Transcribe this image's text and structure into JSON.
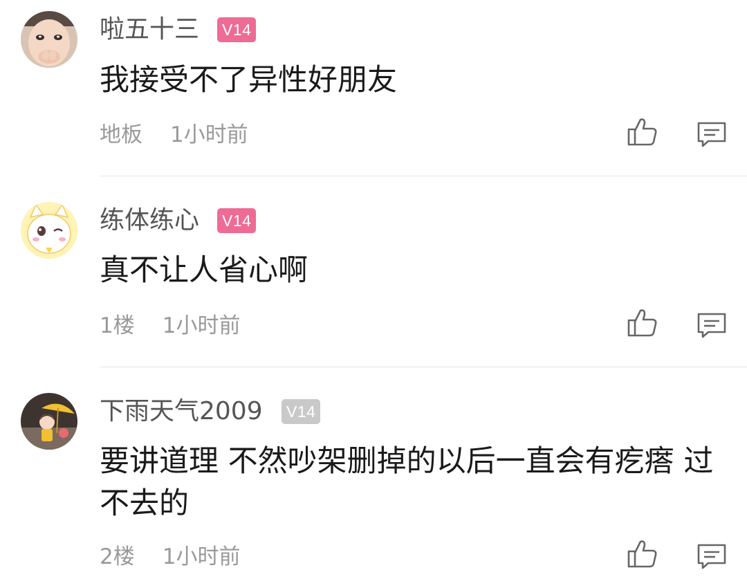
{
  "colors": {
    "badge_active": "#ee6b95",
    "badge_inactive": "#c9c9c9",
    "meta_text": "#999999",
    "divider": "#e6e6e6"
  },
  "comments": [
    {
      "username": "啦五十三",
      "level": "V14",
      "badge_state": "active",
      "avatar": "child-photo-avatar",
      "text": "我接受不了异性好朋友",
      "floor": "地板",
      "time": "1小时前",
      "like_icon": "thumbs-up-icon",
      "reply_icon": "comment-icon"
    },
    {
      "username": "练体练心",
      "level": "V14",
      "badge_state": "active",
      "avatar": "cartoon-cat-avatar",
      "text": "真不让人省心啊",
      "floor": "1楼",
      "time": "1小时前",
      "like_icon": "thumbs-up-icon",
      "reply_icon": "comment-icon"
    },
    {
      "username": "下雨天气2009",
      "level": "V14",
      "badge_state": "inactive",
      "avatar": "umbrella-girl-avatar",
      "text": "要讲道理 不然吵架删掉的以后一直会有疙瘩 过不去的",
      "floor": "2楼",
      "time": "1小时前",
      "like_icon": "thumbs-up-icon",
      "reply_icon": "comment-icon"
    }
  ]
}
